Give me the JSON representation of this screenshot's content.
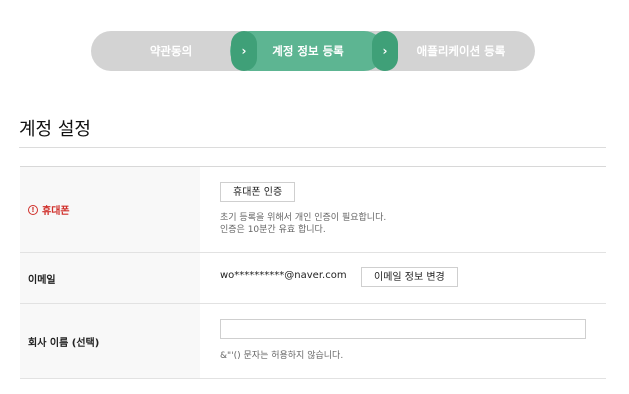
{
  "stepper": {
    "steps": [
      {
        "label": "약관동의",
        "state": "done"
      },
      {
        "label": "계정 정보 등록",
        "state": "active"
      },
      {
        "label": "애플리케이션 등록",
        "state": "pending"
      }
    ],
    "arrow_glyph": "›"
  },
  "page": {
    "title": "계정 설정"
  },
  "form": {
    "phone": {
      "label": "휴대폰",
      "warn_glyph": "!",
      "verify_button": "휴대폰 인증",
      "help_line1": "초기 등록을 위해서 개인 인증이 필요합니다.",
      "help_line2": "인증은 10분간 유효 합니다."
    },
    "email": {
      "label": "이메일",
      "value": "wo**********@naver.com",
      "change_button": "이메일 정보 변경"
    },
    "company": {
      "label": "회사 이름 (선택)",
      "value": "",
      "placeholder": "",
      "help": "&\"'() 문자는 허용하지 않습니다."
    }
  },
  "colors": {
    "active_step": "#5db592",
    "active_arrow": "#3fa078",
    "inactive_step": "#d3d3d3",
    "required_label": "#d0302b",
    "label_bg": "#f8f8f8"
  }
}
